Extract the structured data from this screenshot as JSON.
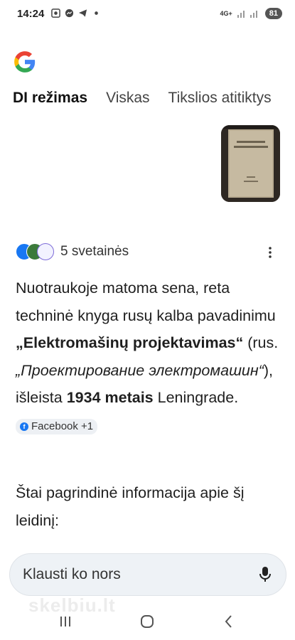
{
  "status_bar": {
    "time": "14:24",
    "network": "4G+",
    "battery": "81"
  },
  "tabs": [
    {
      "label": "DI režimas",
      "active": true
    },
    {
      "label": "Viskas",
      "active": false
    },
    {
      "label": "Tikslios atitiktys",
      "active": false
    }
  ],
  "answer": {
    "sources_label": "5 svetainės",
    "p1": {
      "t1": "Nuotraukoje matoma sena, reta techninė knyga rusų kalba pavadinimu ",
      "b1": "„Elektromašinų projektavimas“",
      "t2": " (rus. ",
      "i1": "„Проектирование электромашин“",
      "t3": "), išleista ",
      "b2": "1934 metais",
      "t4": " Leningrade. "
    },
    "citation_chip": "Facebook +1",
    "p2": "Štai pagrindinė informacija apie šį leidinį:"
  },
  "ask_bar": {
    "placeholder": "Klausti ko nors"
  },
  "watermark": "skelbiu.lt",
  "icons": [
    "google-logo",
    "search-icon",
    "messenger-icon",
    "telegram-icon",
    "facebook-icon",
    "more-vert-icon",
    "mic-icon",
    "recents-icon",
    "home-icon",
    "back-icon"
  ]
}
